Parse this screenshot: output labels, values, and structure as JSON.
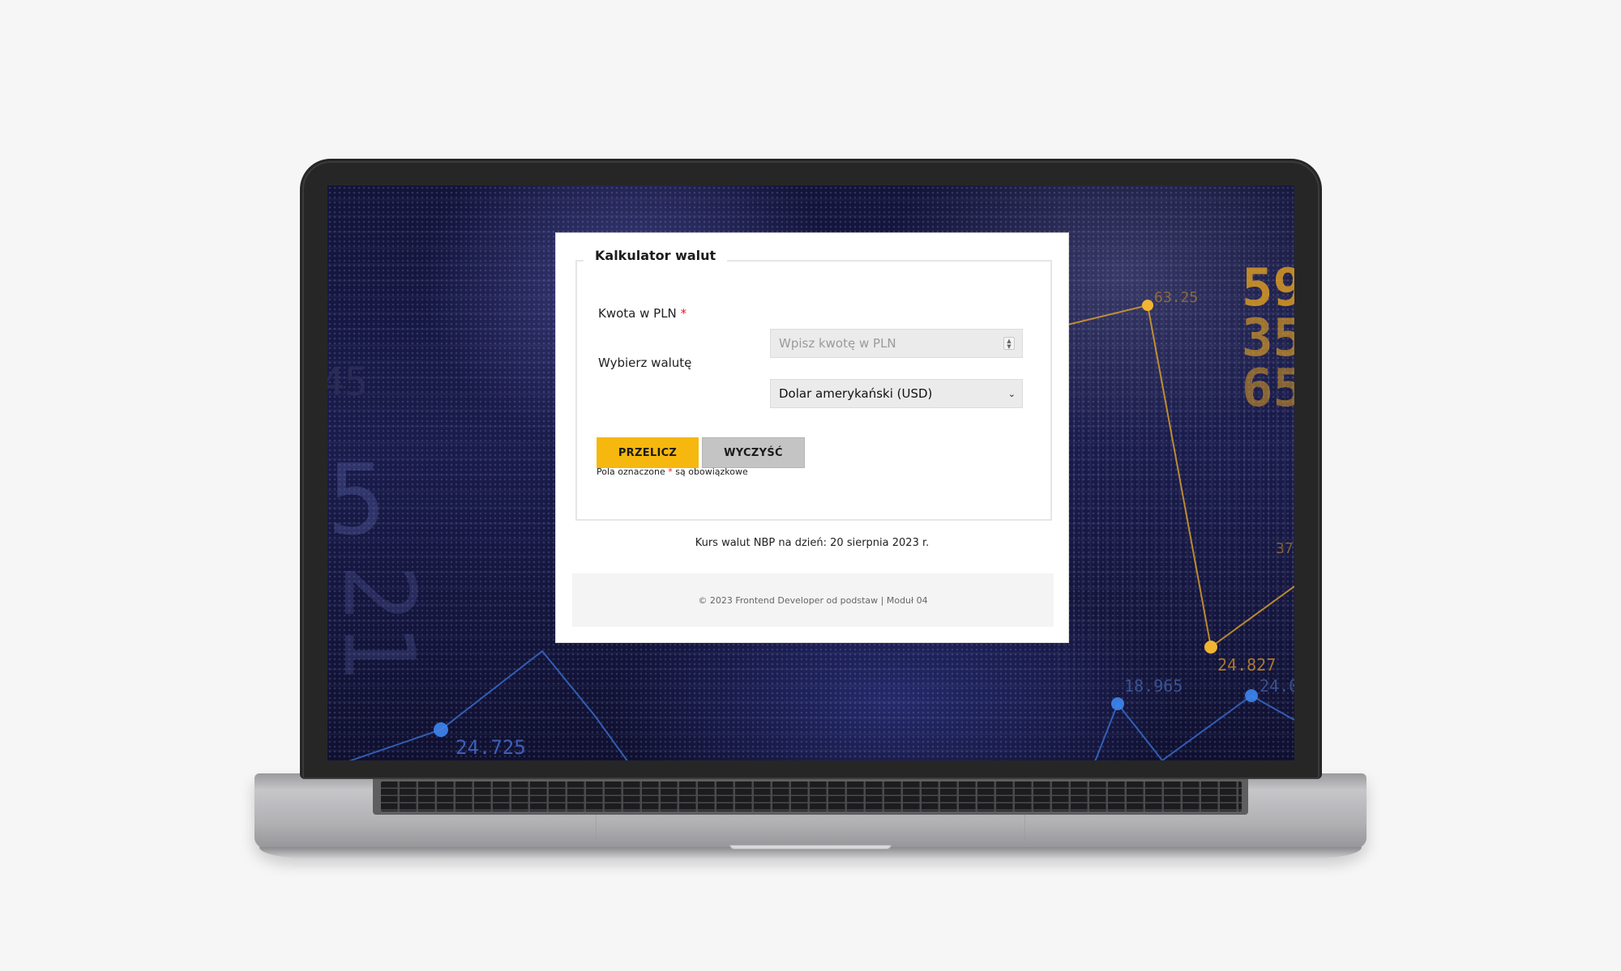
{
  "form": {
    "title": "Kalkulator walut",
    "amount_label": "Kwota w PLN",
    "required_mark": "*",
    "amount_value": "",
    "amount_placeholder": "Wpisz kwotę w PLN",
    "currency_label": "Wybierz walutę",
    "currency_selected": "Dolar amerykański (USD)",
    "convert_button": "PRZELICZ",
    "clear_button": "WYCZYŚĆ",
    "note_before": "Pola oznaczone",
    "note_after": "są obowiązkowe"
  },
  "rate_info": "Kurs walut NBP na dzień: 20 sierpnia 2023 r.",
  "footer": {
    "text": "© 2023 Frontend Developer od podstaw | Moduł 04"
  },
  "background_numbers": {
    "left_top": "45",
    "left_mid": "5",
    "left_low": "21",
    "bottom_left": "24.725",
    "right_big_1": "59",
    "right_big_2": "35",
    "right_big_3": "65",
    "right_small": "63.25",
    "right_mid": "37.",
    "right_chart_1": "24.827",
    "right_chart_2": "18.965",
    "right_chart_3": "24.0"
  },
  "colors": {
    "accent": "#f6b80e",
    "secondary_button": "#c4c4c4",
    "required": "#e31b23",
    "screen_bg": "#15173f"
  }
}
